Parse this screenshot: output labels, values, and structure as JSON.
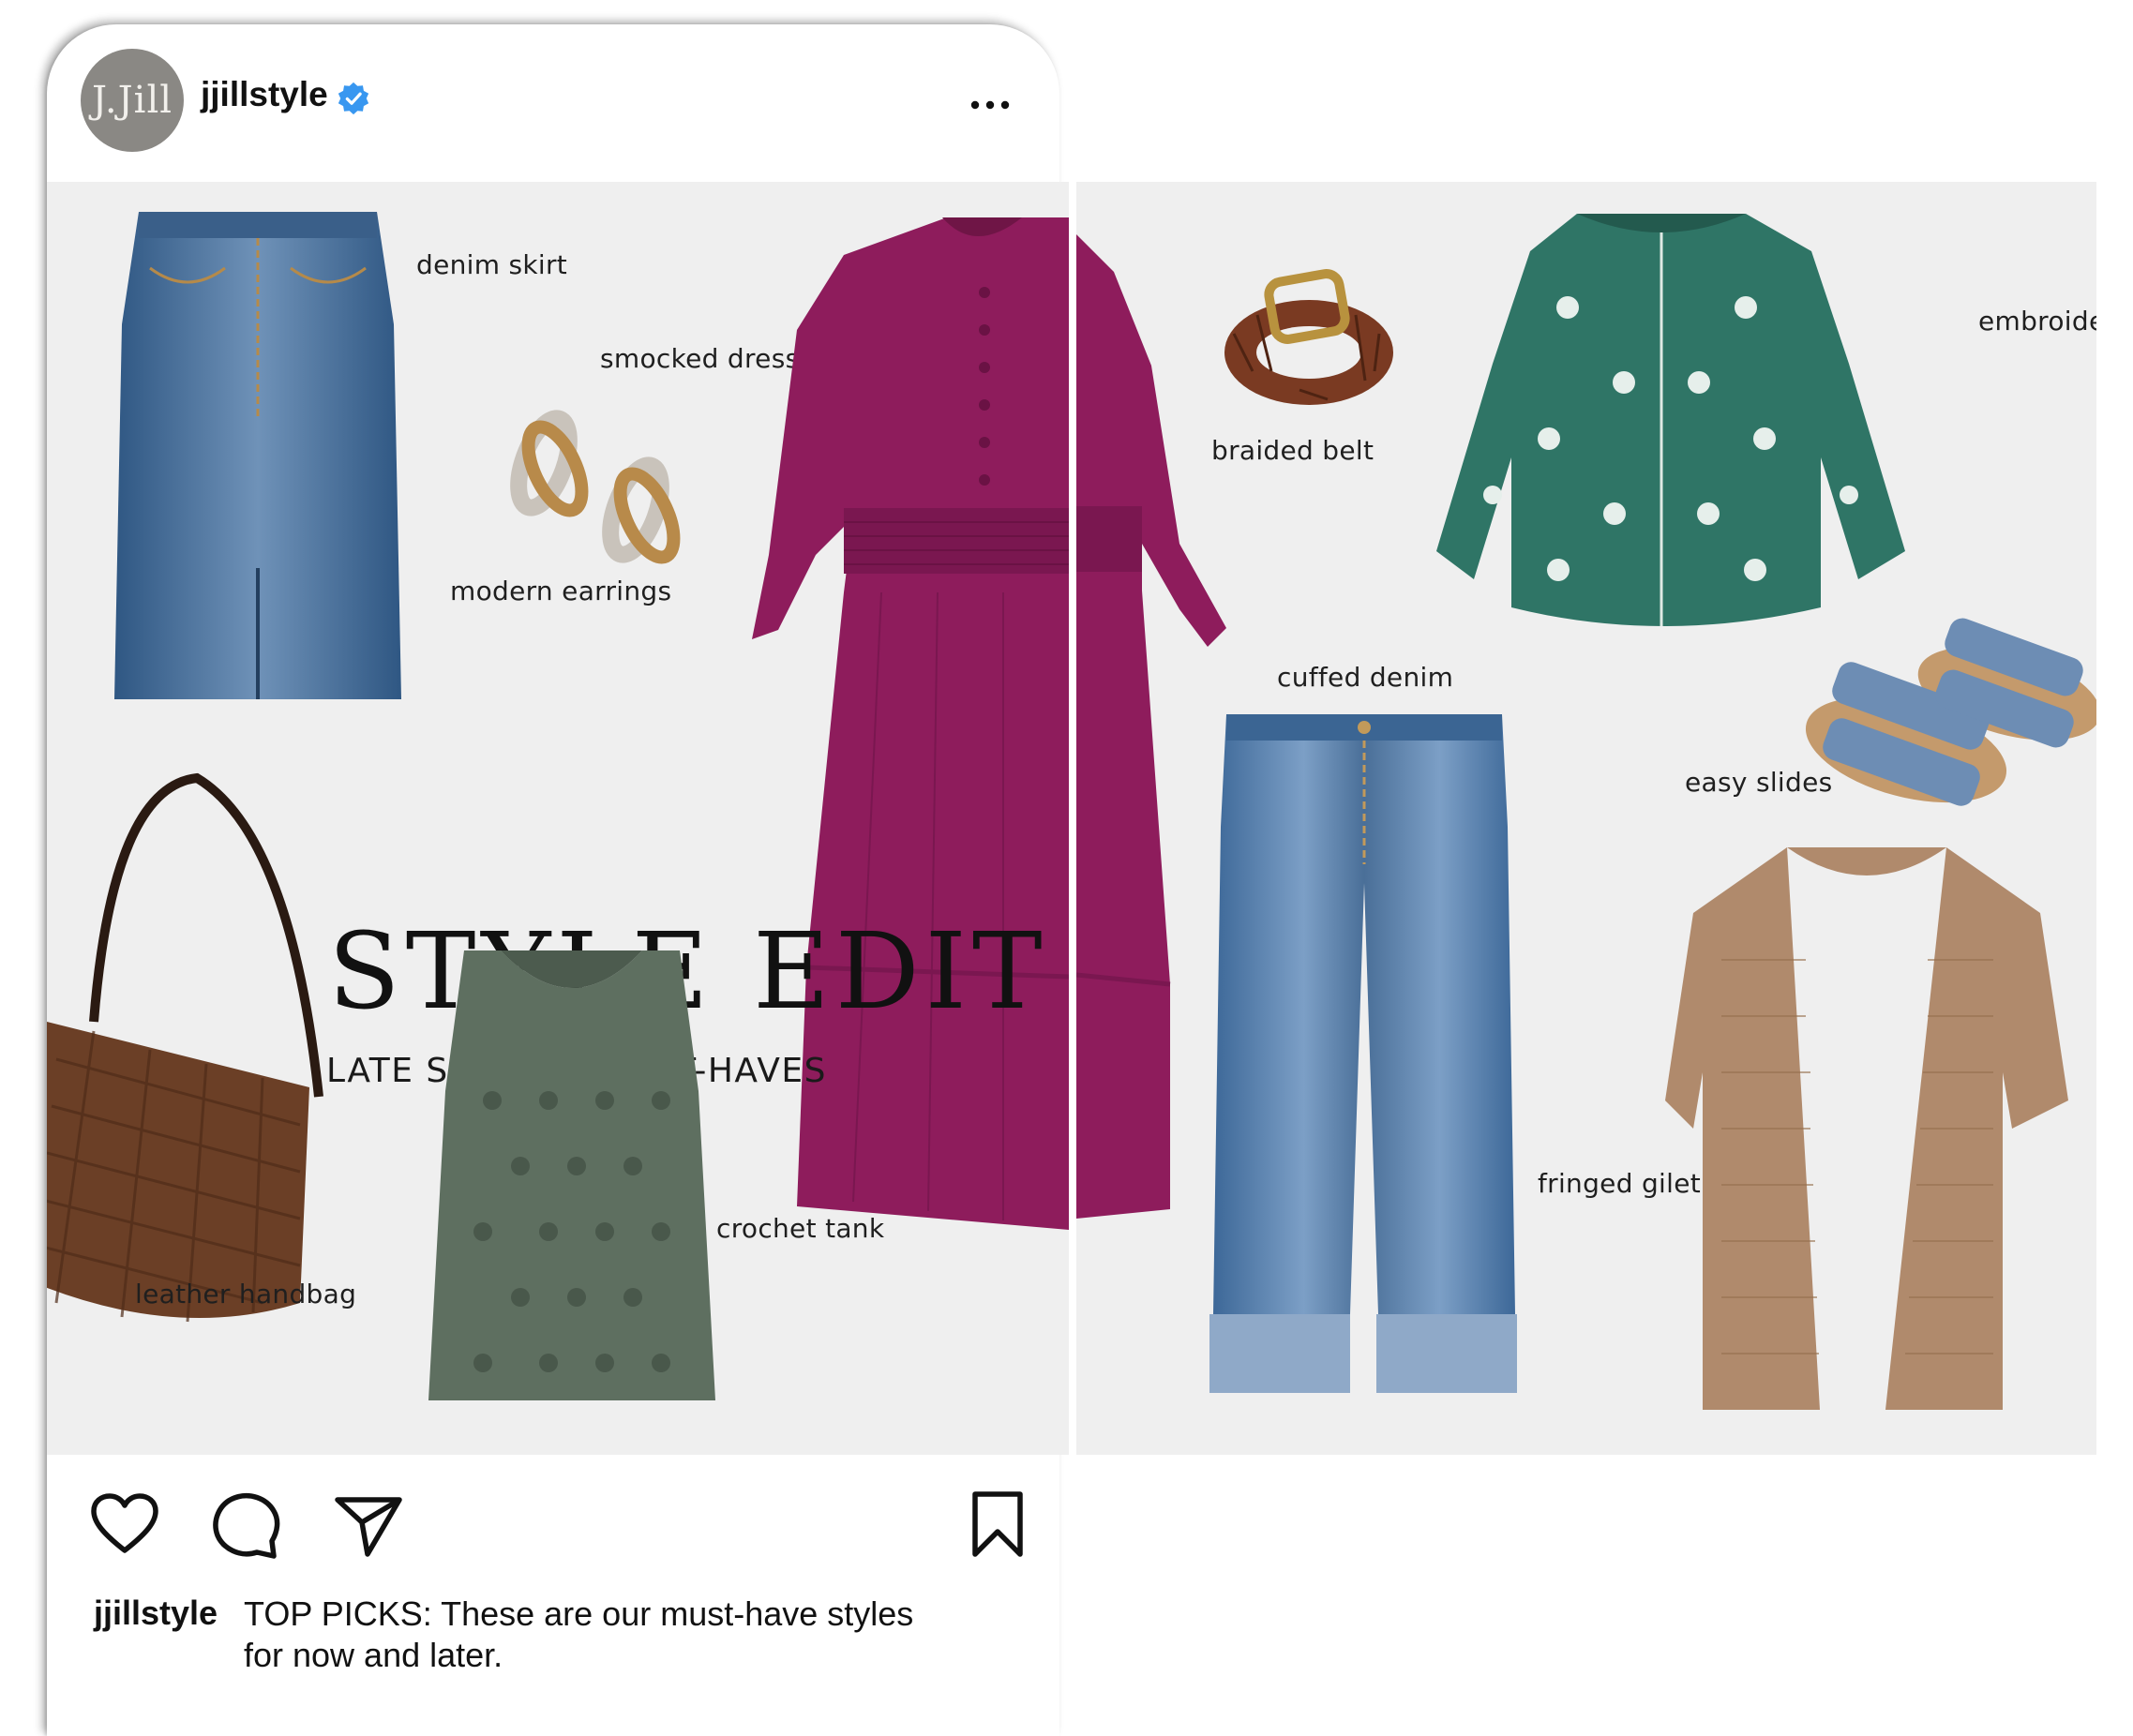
{
  "post": {
    "username": "jjillstyle",
    "avatar_text": "J.Jill",
    "verified": true,
    "more_icon": "more-horizontal-icon"
  },
  "graphic": {
    "title": "STYLE EDIT",
    "subtitle": "LATE SUMMER MUST-HAVES",
    "labels": {
      "denim_skirt": "denim skirt",
      "smocked_dress": "smocked dress",
      "modern_earrings": "modern earrings",
      "leather_handbag": "leather handbag",
      "crochet_tank": "crochet tank",
      "braided_belt": "braided belt",
      "embroidered_top": "embroidered top",
      "cuffed_denim": "cuffed denim",
      "easy_slides": "easy slides",
      "fringed_gilet": "fringed gilet"
    },
    "colors": {
      "background": "#efefef",
      "dress": "#8e1c5c",
      "denim": "#4a6f98",
      "tank": "#5e6f60",
      "top": "#2f7566",
      "gilet": "#b08a6c",
      "handbag": "#6b3f26",
      "slides": "#6d8db4"
    }
  },
  "actions": {
    "like_icon": "heart-icon",
    "comment_icon": "comment-icon",
    "share_icon": "share-icon",
    "save_icon": "bookmark-icon"
  },
  "caption": {
    "username": "jjillstyle",
    "text": "TOP PICKS: These are our must-have styles for now and later."
  }
}
